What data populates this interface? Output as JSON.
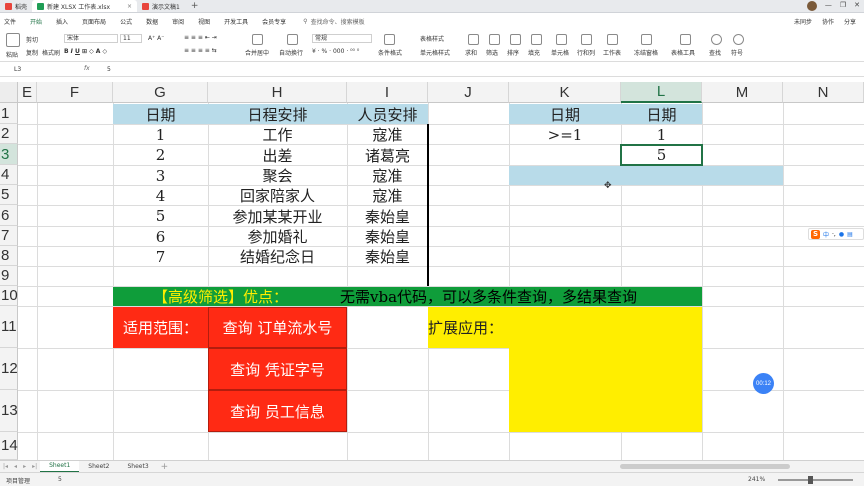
{
  "tabs": [
    {
      "label": "稻壳",
      "color": "#e8453c"
    },
    {
      "label": "新建 XLSX 工作表.xlsx",
      "color": "#1f9d55"
    },
    {
      "label": "演示文稿1",
      "color": "#e8453c"
    }
  ],
  "menu": {
    "file": "文件",
    "items": [
      "开始",
      "插入",
      "页面布局",
      "公式",
      "数据",
      "审阅",
      "视图",
      "开发工具",
      "会员专享"
    ],
    "active": "开始",
    "search": "查找命令、搜索模板",
    "right": [
      "未同步",
      "协作",
      "分享"
    ]
  },
  "ribbon": {
    "paste": "粘贴",
    "cut": "剪切",
    "copy": "复制",
    "format_painter": "格式刷",
    "font_name": "宋体",
    "font_size": "11",
    "merge_center": "合并居中",
    "auto_wrap": "自动换行",
    "number_format": "常规",
    "cond_format": "条件格式",
    "table_style": "表格样式",
    "cell_style": "单元格样式",
    "sum": "求和",
    "filter": "筛选",
    "sort": "排序",
    "fill": "填充",
    "cell": "单元格",
    "row_col": "行和列",
    "worksheet": "工作表",
    "freeze": "冻结窗格",
    "table_tools": "表格工具",
    "find": "查找",
    "symbol": "符号"
  },
  "formula_bar": {
    "name_box": "L3",
    "fx": "fx",
    "value": "5"
  },
  "columns": [
    "E",
    "F",
    "G",
    "H",
    "I",
    "J",
    "K",
    "L",
    "M",
    "N"
  ],
  "selected_column": "L",
  "rows": [
    "1",
    "2",
    "3",
    "4",
    "5",
    "6",
    "7",
    "8",
    "9",
    "10",
    "11",
    "12",
    "13",
    "14"
  ],
  "selected_row": "3",
  "sheet": {
    "table_headers": [
      "日期",
      "日程安排",
      "人员安排"
    ],
    "table_rows": [
      [
        "1",
        "工作",
        "寇准"
      ],
      [
        "2",
        "出差",
        "诸葛亮"
      ],
      [
        "3",
        "聚会",
        "寇准"
      ],
      [
        "4",
        "回家陪家人",
        "寇准"
      ],
      [
        "5",
        "参加某某开业",
        "秦始皇"
      ],
      [
        "6",
        "参加婚礼",
        "秦始皇"
      ],
      [
        "7",
        "结婚纪念日",
        "秦始皇"
      ]
    ],
    "criteria_headers": [
      "日期",
      "日期"
    ],
    "criteria_values": [
      ">=1",
      "1"
    ],
    "criteria_value2": "5",
    "banner_title": "【高级筛选】优点：",
    "banner_text": "无需vba代码，可以多条件查询，多结果查询",
    "scope_label": "适用范围：",
    "scope_items": [
      "查询  订单流水号",
      "查询      凭证字号",
      "查询    员工信息"
    ],
    "extension_label": "扩展应用："
  },
  "colors": {
    "header_fill": "#b8dbe9",
    "banner_green": "#0f9d3a",
    "scope_red": "#ff2a14",
    "extension_yellow": "#ffee00",
    "banner_title_color": "#ffee00",
    "accent": "#217346"
  },
  "ime": {
    "label": "中"
  },
  "timer": "00:12",
  "sheet_tabs": [
    "Sheet1",
    "Sheet2",
    "Sheet3"
  ],
  "active_sheet": "Sheet1",
  "status": {
    "mode": "项目管理",
    "value": "5",
    "zoom": "241%"
  }
}
